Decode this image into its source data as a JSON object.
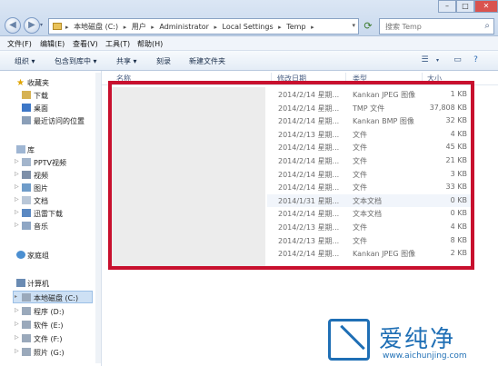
{
  "address_bar": {
    "crumbs": [
      "本地磁盘 (C:)",
      "用户",
      "Administrator",
      "Local Settings",
      "Temp"
    ],
    "search_placeholder": "搜索 Temp"
  },
  "menu": [
    "文件(F)",
    "编辑(E)",
    "查看(V)",
    "工具(T)",
    "帮助(H)"
  ],
  "toolbar": {
    "organize": "组织 ▾",
    "include_in_library": "包含到库中 ▾",
    "share": "共享 ▾",
    "burn": "刻录",
    "new_folder": "新建文件夹"
  },
  "sidebar": {
    "favorites": "收藏夹",
    "download": "下载",
    "desktop": "桌面",
    "recent": "最近访问的位置",
    "library": "库",
    "pptv": "PPTV视频",
    "video": "视频",
    "pictures": "图片",
    "documents": "文档",
    "thunder": "迅雷下载",
    "music": "音乐",
    "homegroup": "家庭组",
    "computer": "计算机",
    "drive_c": "本地磁盘 (C:)",
    "drive_d": "程序 (D:)",
    "drive_e": "软件 (E:)",
    "drive_f": "文件 (F:)",
    "drive_g": "照片 (G:)"
  },
  "columns": {
    "name": "名称",
    "date": "修改日期",
    "type": "类型",
    "size": "大小"
  },
  "files": [
    {
      "date": "2014/2/14 星期...",
      "type": "Kankan JPEG 图像",
      "size": "1 KB"
    },
    {
      "date": "2014/2/14 星期...",
      "type": "TMP 文件",
      "size": "37,808 KB"
    },
    {
      "date": "2014/2/14 星期...",
      "type": "Kankan BMP 图像",
      "size": "32 KB"
    },
    {
      "date": "2014/2/13 星期...",
      "type": "文件",
      "size": "4 KB"
    },
    {
      "date": "2014/2/14 星期...",
      "type": "文件",
      "size": "45 KB"
    },
    {
      "date": "2014/2/14 星期...",
      "type": "文件",
      "size": "21 KB"
    },
    {
      "date": "2014/2/14 星期...",
      "type": "文件",
      "size": "3 KB"
    },
    {
      "date": "2014/2/14 星期...",
      "type": "文件",
      "size": "33 KB"
    },
    {
      "date": "2014/1/31 星期...",
      "type": "文本文档",
      "size": "0 KB"
    },
    {
      "date": "2014/2/14 星期...",
      "type": "文本文档",
      "size": "0 KB"
    },
    {
      "date": "2014/2/13 星期...",
      "type": "文件",
      "size": "4 KB"
    },
    {
      "date": "2014/2/13 星期...",
      "type": "文件",
      "size": "8 KB"
    },
    {
      "date": "2014/2/14 星期...",
      "type": "Kankan JPEG 图像",
      "size": "2 KB"
    }
  ],
  "watermark": {
    "title": "爱纯净",
    "url": "www.aichunjing.com"
  },
  "colors": {
    "highlight_frame": "#c8102e",
    "watermark": "#1f6fb5"
  }
}
